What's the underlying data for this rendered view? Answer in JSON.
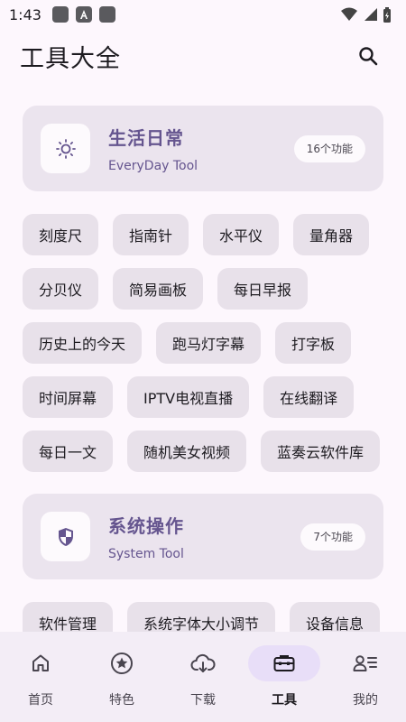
{
  "status_bar": {
    "time": "1:43"
  },
  "header": {
    "title": "工具大全"
  },
  "categories": [
    {
      "title": "生活日常",
      "subtitle": "EveryDay Tool",
      "count": "16个功能",
      "icon": "sun-icon"
    },
    {
      "title": "系统操作",
      "subtitle": "System Tool",
      "count": "7个功能",
      "icon": "shield-icon"
    }
  ],
  "life_tools": [
    "刻度尺",
    "指南针",
    "水平仪",
    "量角器",
    "分贝仪",
    "简易画板",
    "每日早报",
    "历史上的今天",
    "跑马灯字幕",
    "打字板",
    "时间屏幕",
    "IPTV电视直播",
    "在线翻译",
    "每日一文",
    "随机美女视频",
    "蓝奏云软件库"
  ],
  "system_tools": [
    "软件管理",
    "系统字体大小调节",
    "设备信息"
  ],
  "nav": [
    {
      "label": "首页",
      "icon": "home-icon"
    },
    {
      "label": "特色",
      "icon": "star-icon"
    },
    {
      "label": "下载",
      "icon": "cloud-download-icon"
    },
    {
      "label": "工具",
      "icon": "toolbox-icon",
      "active": true
    },
    {
      "label": "我的",
      "icon": "profile-icon"
    }
  ],
  "colors": {
    "accent": "#65558f",
    "background": "#fdf7fd",
    "card": "#ebe4ee",
    "chip": "#e8e1ea",
    "nav": "#f3edf6",
    "nav_active": "#e8def8"
  }
}
